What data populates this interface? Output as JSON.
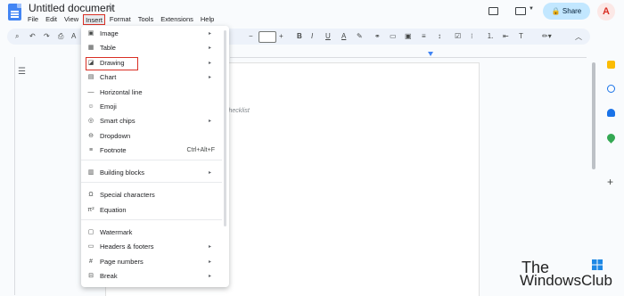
{
  "title": "Untitled document",
  "menubar": [
    "File",
    "Edit",
    "View",
    "Insert",
    "Format",
    "Tools",
    "Extensions",
    "Help"
  ],
  "active_menu": "Insert",
  "share_label": "Share",
  "avatar_letter": "A",
  "toolbar": {
    "font_size_minus": "−",
    "font_size_plus": "+",
    "bold": "B",
    "italic": "I",
    "underline": "U",
    "text_color": "A"
  },
  "document": {
    "placeholder_hint": "checklist"
  },
  "insert_menu": {
    "items": [
      {
        "label": "Image",
        "icon": "image-icon",
        "glyph": "▣",
        "arrow": "▸",
        "shortcut": ""
      },
      {
        "label": "Table",
        "icon": "table-icon",
        "glyph": "▦",
        "arrow": "▸",
        "shortcut": ""
      },
      {
        "label": "Drawing",
        "icon": "drawing-icon",
        "glyph": "◪",
        "arrow": "▸",
        "shortcut": ""
      },
      {
        "label": "Chart",
        "icon": "chart-icon",
        "glyph": "▤",
        "arrow": "▸",
        "shortcut": ""
      },
      {
        "label": "Horizontal line",
        "icon": "horizontal-line-icon",
        "glyph": "—",
        "arrow": "",
        "shortcut": ""
      },
      {
        "label": "Emoji",
        "icon": "emoji-icon",
        "glyph": "☺",
        "arrow": "",
        "shortcut": ""
      },
      {
        "label": "Smart chips",
        "icon": "smart-chips-icon",
        "glyph": "◎",
        "arrow": "▸",
        "shortcut": ""
      },
      {
        "label": "Dropdown",
        "icon": "dropdown-icon",
        "glyph": "⊖",
        "arrow": "",
        "shortcut": ""
      },
      {
        "label": "Footnote",
        "icon": "footnote-icon",
        "glyph": "≡",
        "arrow": "",
        "shortcut": "Ctrl+Alt+F"
      },
      {
        "label": "Building blocks",
        "icon": "building-blocks-icon",
        "glyph": "▥",
        "arrow": "▸",
        "shortcut": ""
      },
      {
        "label": "Special characters",
        "icon": "special-characters-icon",
        "glyph": "Ω",
        "arrow": "",
        "shortcut": ""
      },
      {
        "label": "Equation",
        "icon": "equation-icon",
        "glyph": "π²",
        "arrow": "",
        "shortcut": ""
      },
      {
        "label": "Watermark",
        "icon": "watermark-icon",
        "glyph": "▢",
        "arrow": "",
        "shortcut": ""
      },
      {
        "label": "Headers & footers",
        "icon": "headers-footers-icon",
        "glyph": "▭",
        "arrow": "▸",
        "shortcut": ""
      },
      {
        "label": "Page numbers",
        "icon": "page-numbers-icon",
        "glyph": "#",
        "arrow": "▸",
        "shortcut": ""
      },
      {
        "label": "Break",
        "icon": "break-icon",
        "glyph": "⊟",
        "arrow": "▸",
        "shortcut": ""
      }
    ]
  },
  "watermark": {
    "line1": "The",
    "line2": "WindowsClub"
  },
  "colors": {
    "accent": "#d93025",
    "share_bg": "#c2e7ff",
    "doc_blue": "#4285f4"
  }
}
